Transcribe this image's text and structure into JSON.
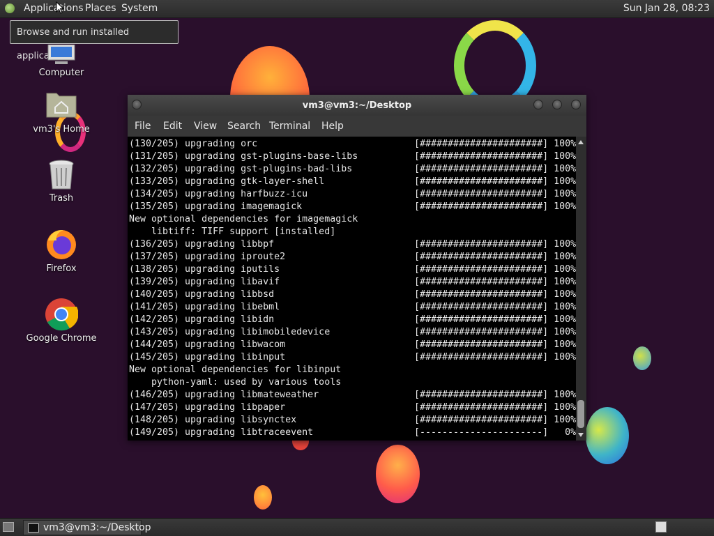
{
  "top_panel": {
    "menus": [
      "Applications",
      "Places",
      "System"
    ],
    "clock": "Sun Jan 28, 08:23",
    "logo_icon": "gnome-foot-icon"
  },
  "tooltip": {
    "text": "Browse and run installed applications"
  },
  "desktop": {
    "icons": [
      {
        "label": "Computer",
        "icon": "computer-icon"
      },
      {
        "label": "vm3's Home",
        "icon": "home-folder-icon"
      },
      {
        "label": "Trash",
        "icon": "trash-icon"
      },
      {
        "label": "Firefox",
        "icon": "firefox-icon"
      },
      {
        "label": "Google Chrome",
        "icon": "chrome-icon"
      }
    ]
  },
  "terminal": {
    "title": "vm3@vm3:~/Desktop",
    "menu": [
      "File",
      "Edit",
      "View",
      "Search",
      "Terminal",
      "Help"
    ],
    "lines": [
      {
        "text": "(130/205) upgrading orc",
        "progress": "[######################] 100%"
      },
      {
        "text": "(131/205) upgrading gst-plugins-base-libs",
        "progress": "[######################] 100%"
      },
      {
        "text": "(132/205) upgrading gst-plugins-bad-libs",
        "progress": "[######################] 100%"
      },
      {
        "text": "(133/205) upgrading gtk-layer-shell",
        "progress": "[######################] 100%"
      },
      {
        "text": "(134/205) upgrading harfbuzz-icu",
        "progress": "[######################] 100%"
      },
      {
        "text": "(135/205) upgrading imagemagick",
        "progress": "[######################] 100%"
      },
      {
        "text": "New optional dependencies for imagemagick",
        "progress": ""
      },
      {
        "text": "    libtiff: TIFF support [installed]",
        "progress": ""
      },
      {
        "text": "(136/205) upgrading libbpf",
        "progress": "[######################] 100%"
      },
      {
        "text": "(137/205) upgrading iproute2",
        "progress": "[######################] 100%"
      },
      {
        "text": "(138/205) upgrading iputils",
        "progress": "[######################] 100%"
      },
      {
        "text": "(139/205) upgrading libavif",
        "progress": "[######################] 100%"
      },
      {
        "text": "(140/205) upgrading libbsd",
        "progress": "[######################] 100%"
      },
      {
        "text": "(141/205) upgrading libebml",
        "progress": "[######################] 100%"
      },
      {
        "text": "(142/205) upgrading libidn",
        "progress": "[######################] 100%"
      },
      {
        "text": "(143/205) upgrading libimobiledevice",
        "progress": "[######################] 100%"
      },
      {
        "text": "(144/205) upgrading libwacom",
        "progress": "[######################] 100%"
      },
      {
        "text": "(145/205) upgrading libinput",
        "progress": "[######################] 100%"
      },
      {
        "text": "New optional dependencies for libinput",
        "progress": ""
      },
      {
        "text": "    python-yaml: used by various tools",
        "progress": ""
      },
      {
        "text": "(146/205) upgrading libmateweather",
        "progress": "[######################] 100%"
      },
      {
        "text": "(147/205) upgrading libpaper",
        "progress": "[######################] 100%"
      },
      {
        "text": "(148/205) upgrading libsynctex",
        "progress": "[######################] 100%"
      },
      {
        "text": "(149/205) upgrading libtraceevent",
        "progress": "[----------------------]   0%"
      }
    ]
  },
  "taskbar": {
    "window_label": "vm3@vm3:~/Desktop",
    "window_icon": "terminal-icon"
  },
  "colors": {
    "desktop_bg": "#2a0f2c",
    "panel": "#333333",
    "terminal_bg": "#000000",
    "terminal_fg": "#e6e6e6"
  }
}
